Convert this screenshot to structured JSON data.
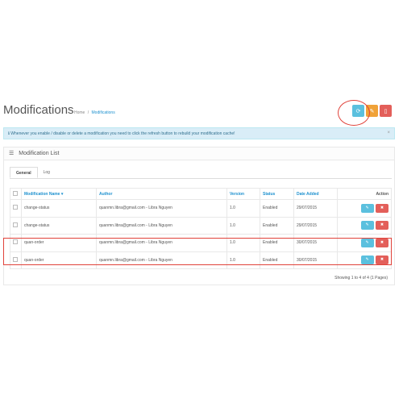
{
  "page": {
    "title": "Modifications",
    "breadcrumb": [
      {
        "label": "Home"
      },
      {
        "label": "Modifications"
      }
    ]
  },
  "header_buttons": [
    {
      "icon": "refresh-icon",
      "glyph": "⟳",
      "color": "#5bc0de"
    },
    {
      "icon": "eraser-icon",
      "glyph": "✎",
      "color": "#f0a238"
    },
    {
      "icon": "trash-icon",
      "glyph": "▯",
      "color": "#e35f5a"
    }
  ],
  "alert": {
    "icon": "info-circle-icon",
    "text": "Whenever you enable / disable or delete a modification you need to click the refresh button to rebuild your modification cache!",
    "close": "×"
  },
  "panel": {
    "title": "Modification List",
    "tabs": [
      {
        "label": "General",
        "active": true
      },
      {
        "label": "Log",
        "active": false
      }
    ]
  },
  "table": {
    "headers": {
      "name": "Modification Name ▾",
      "author": "Author",
      "version": "Version",
      "status": "Status",
      "date_added": "Date Added",
      "action": "Action"
    },
    "rows": [
      {
        "name": "change-status",
        "author": "quanmn.libra@gmail.com - Libra Nguyen",
        "version": "1.0",
        "status": "Enabled",
        "date_added": "29/07/2015"
      },
      {
        "name": "change-status",
        "author": "quanmn.libra@gmail.com - Libra Nguyen",
        "version": "1.0",
        "status": "Enabled",
        "date_added": "29/07/2015"
      },
      {
        "name": "quan-order",
        "author": "quanmn.libra@gmail.com - Libra Nguyen",
        "version": "1.0",
        "status": "Enabled",
        "date_added": "30/07/2015"
      },
      {
        "name": "quan-order",
        "author": "quanmn.libra@gmail.com - Libra Nguyen",
        "version": "1.0",
        "status": "Enabled",
        "date_added": "30/07/2015"
      }
    ],
    "edit_glyph": "✎",
    "delete_glyph": "✖"
  },
  "pagination": {
    "text": "Showing 1 to 4 of 4 (1 Pages)"
  },
  "colors": {
    "accent": "#1e91cf",
    "info": "#5bc0de",
    "warning": "#f0a238",
    "danger": "#e35f5a",
    "annotation": "#e0423a"
  }
}
